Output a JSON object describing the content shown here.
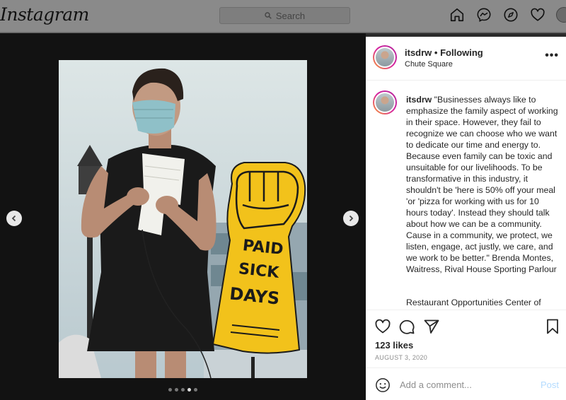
{
  "header": {
    "logo": "Instagram",
    "search_placeholder": "Search"
  },
  "nav_icons": [
    "home-icon",
    "messenger-icon",
    "explore-icon",
    "heart-icon",
    "avatar"
  ],
  "post": {
    "username": "itsdrw",
    "follow_status": "• Following",
    "location": "Chute Square",
    "caption_user": "itsdrw",
    "caption_text": "\"Businesses always like to emphasize the family aspect of working in their space. However, they fail to recognize we can choose who we want to dedicate our time and energy to. Because even family can be toxic and unsuitable for our livelihoods. To be transformative in this industry, it shouldn't be 'here is 50% off your meal 'or 'pizza for working with us for 10 hours today'. Instead they should talk about how we can be a community. Cause in a community, we protect, we listen, engage, act justly, we care, and we work to be better.\" Brenda Montes, Waitress, Rival House Sporting Parlour",
    "caption_more": "Restaurant Opportunities Center of",
    "likes": "123 likes",
    "date": "AUGUST 3, 2020",
    "comment_placeholder": "Add a comment...",
    "post_button": "Post",
    "sign_text": [
      "PAID",
      "SICK",
      "DAYS"
    ]
  },
  "carousel": {
    "slide_count": 5,
    "active_index": 3
  },
  "colors": {
    "sign_yellow": "#f2c21b",
    "post_link": "#b3dbff",
    "backdrop": "#121212"
  }
}
